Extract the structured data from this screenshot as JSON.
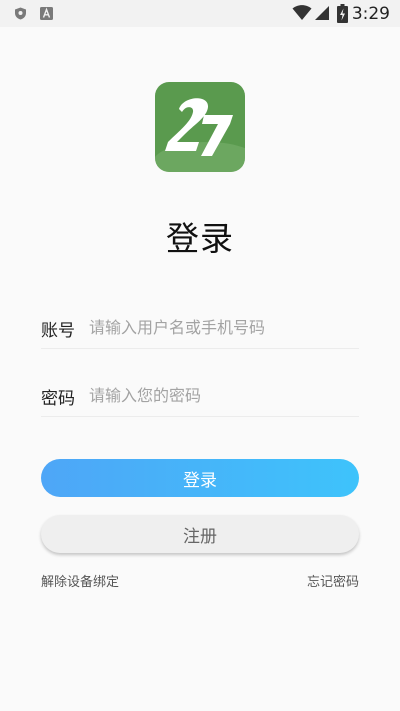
{
  "status_bar": {
    "time": "3:29",
    "icons": [
      "shield-icon",
      "font-a-icon",
      "wifi-icon",
      "signal-icon",
      "battery-charging-icon"
    ]
  },
  "logo": {
    "text": "27",
    "color": "#5a9a4e"
  },
  "page_title": "登录",
  "account": {
    "label": "账号",
    "placeholder": "请输入用户名或手机号码",
    "value": ""
  },
  "password": {
    "label": "密码",
    "placeholder": "请输入您的密码",
    "value": ""
  },
  "buttons": {
    "login_label": "登录",
    "register_label": "注册"
  },
  "links": {
    "unbind_device": "解除设备绑定",
    "forgot_password": "忘记密码"
  },
  "colors": {
    "login_gradient_start": "#4ea6f7",
    "login_gradient_end": "#3ec3fb",
    "register_bg": "#efefef"
  }
}
